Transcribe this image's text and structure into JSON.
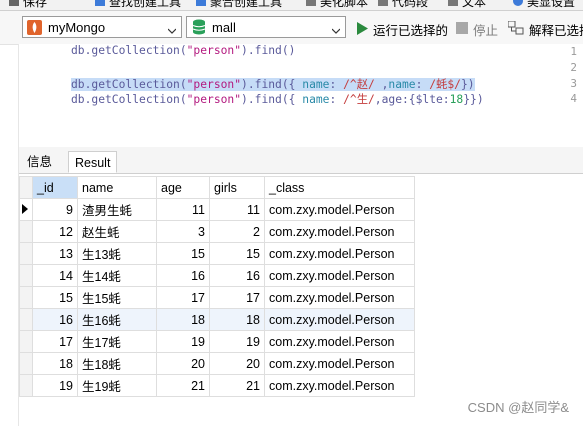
{
  "top_toolbar": {
    "items": [
      "保存",
      "查找创建工具",
      "聚合创建工具",
      "美化脚本",
      "代码段",
      "文本",
      "美显设置"
    ]
  },
  "toolbar": {
    "connection": "myMongo",
    "database": "mall",
    "run_selected_label": "运行已选择的",
    "stop_label": "停止",
    "explain_label": "解释已选择"
  },
  "editor": {
    "lines": [
      {
        "num": "1",
        "text": "db.getCollection(\"person\").find()"
      },
      {
        "num": "2",
        "text": ""
      },
      {
        "num": "3",
        "text": "db.getCollection(\"person\").find({ name: /^赵/ ,name: /蚝$/})"
      },
      {
        "num": "4",
        "text": "db.getCollection(\"person\").find({ name: /^生/,age:{$lte:18}})"
      }
    ]
  },
  "tabs": [
    {
      "label": "信息"
    },
    {
      "label": "Result"
    }
  ],
  "grid": {
    "columns": [
      "_id",
      "name",
      "age",
      "girls",
      "_class"
    ],
    "rows": [
      [
        "9",
        "渣男生蚝",
        "11",
        "11",
        "com.zxy.model.Person"
      ],
      [
        "12",
        "赵生蚝",
        "3",
        "2",
        "com.zxy.model.Person"
      ],
      [
        "13",
        "生13蚝",
        "15",
        "15",
        "com.zxy.model.Person"
      ],
      [
        "14",
        "生14蚝",
        "16",
        "16",
        "com.zxy.model.Person"
      ],
      [
        "15",
        "生15蚝",
        "17",
        "17",
        "com.zxy.model.Person"
      ],
      [
        "16",
        "生16蚝",
        "18",
        "18",
        "com.zxy.model.Person"
      ],
      [
        "17",
        "生17蚝",
        "19",
        "19",
        "com.zxy.model.Person"
      ],
      [
        "18",
        "生18蚝",
        "20",
        "20",
        "com.zxy.model.Person"
      ],
      [
        "19",
        "生19蚝",
        "21",
        "21",
        "com.zxy.model.Person"
      ]
    ]
  },
  "watermark": "CSDN @赵同学&",
  "colors": {
    "accent": "#2b8a3e",
    "selection": "#c6dcf7",
    "db_icon": "#2aa05a"
  }
}
